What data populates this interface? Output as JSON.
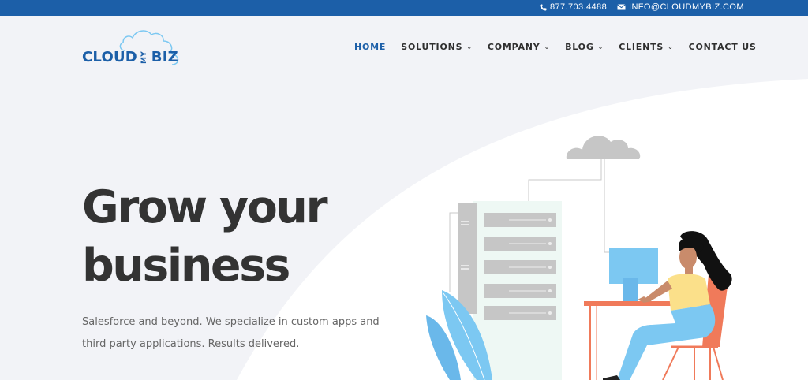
{
  "topbar": {
    "phone": "877.703.4488",
    "email": "INFO@CLOUDMYBIZ.COM",
    "phone_icon": "phone-icon",
    "email_icon": "envelope-icon"
  },
  "logo": {
    "part1": "CLOUD",
    "part2": "MY",
    "part3": "BIZ"
  },
  "nav": [
    {
      "label": "HOME",
      "active": true,
      "dropdown": false
    },
    {
      "label": "SOLUTIONS",
      "dropdown": true
    },
    {
      "label": "COMPANY",
      "dropdown": true
    },
    {
      "label": "BLOG",
      "dropdown": true
    },
    {
      "label": "CLIENTS",
      "dropdown": true
    },
    {
      "label": "CONTACT US",
      "dropdown": false
    }
  ],
  "hero": {
    "title_line1": "Grow your",
    "title_line2": "business",
    "subtitle": "Salesforce and beyond. We specialize in custom apps and third party applications. Results delivered."
  },
  "colors": {
    "topbar": "#1c5fa8",
    "brand": "#1c5fa8",
    "background": "#f2f3f7",
    "accent_orange": "#f07a5a",
    "accent_blue": "#7cc8f2"
  }
}
